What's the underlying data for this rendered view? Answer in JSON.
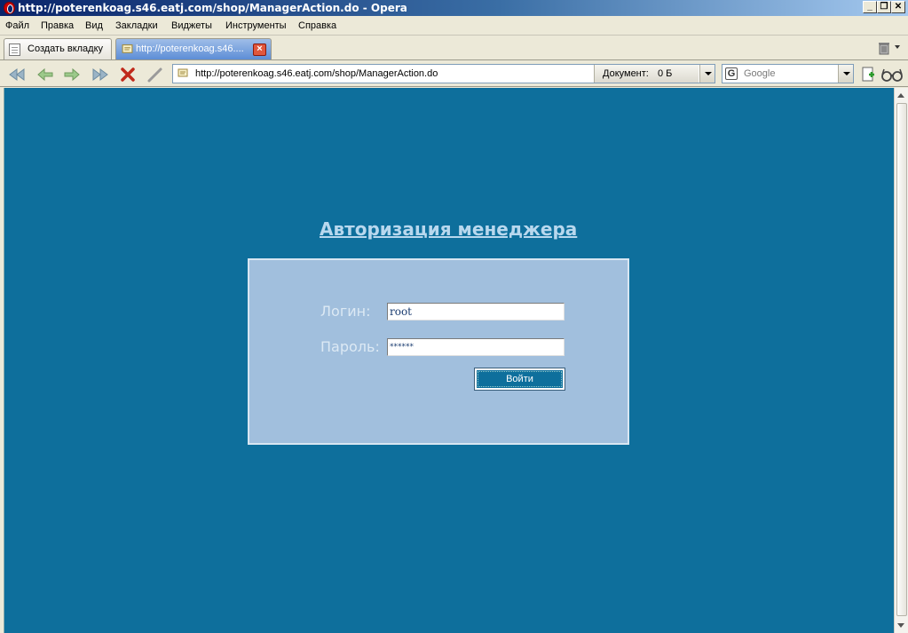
{
  "window": {
    "title": "http://poterenkoag.s46.eatj.com/shop/ManagerAction.do - Opera"
  },
  "menu": {
    "items": [
      "Файл",
      "Правка",
      "Вид",
      "Закладки",
      "Виджеты",
      "Инструменты",
      "Справка"
    ]
  },
  "tabs": {
    "new_tab_label": "Создать вкладку",
    "active_tab_label": "http://poterenkoag.s46...."
  },
  "toolbar": {
    "address_url": "http://poterenkoag.s46.eatj.com/shop/ManagerAction.do",
    "document_label": "Документ:",
    "document_size": "0 Б",
    "search_engine": "Google"
  },
  "page": {
    "heading": "Авторизация менеджера",
    "login_label": "Логин:",
    "login_value": "root",
    "password_label": "Пароль:",
    "password_value": "******",
    "submit_label": "Войти",
    "background_color": "#0e6f9c",
    "panel_color": "#a1bfdd"
  }
}
